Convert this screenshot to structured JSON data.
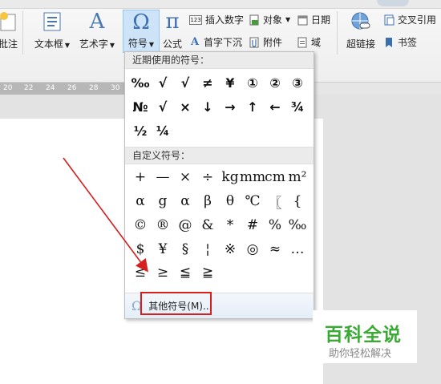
{
  "ribbon": {
    "comment_label": "批注",
    "textbox_label": "文本框",
    "wordart_label": "艺术字",
    "symbol_label": "符号",
    "formula_label": "公式",
    "insert_number": "插入数字",
    "object": "对象",
    "date": "日期",
    "drop_cap": "首字下沉",
    "attachment": "附件",
    "field": "域",
    "hyperlink": "超链接",
    "cross_ref": "交叉引用",
    "bookmark": "书签",
    "number_icon_text": "123"
  },
  "ruler": [
    "20",
    "22",
    "24",
    "26",
    "28",
    "30"
  ],
  "symbol_menu": {
    "recent_title": "近期使用的符号：",
    "recent": [
      "‰",
      "√",
      "√",
      "≠",
      "¥",
      "①",
      "②",
      "③",
      "№",
      "√",
      "×",
      "↓",
      "→",
      "↑",
      "←",
      "¾",
      "½",
      "¼"
    ],
    "custom_title": "自定义符号：",
    "custom": [
      "+",
      "—",
      "×",
      "÷",
      "kg",
      "mm",
      "cm",
      "m²",
      "α",
      "g",
      "α",
      "β",
      "θ",
      "℃",
      "〖",
      "{",
      "©",
      "®",
      "@",
      "&",
      "*",
      "#",
      "%",
      "‰",
      "$",
      "¥",
      "§",
      "¦",
      "※",
      "◎",
      "≈",
      "…",
      "≤",
      "≥",
      "≦",
      "≧"
    ],
    "more_label": "其他符号(M)..."
  },
  "watermark": {
    "title": "百科全说",
    "subtitle": "助你轻松解决"
  },
  "colors": {
    "annotation": "#d61f1f",
    "watermark_green": "#3aaa35"
  }
}
